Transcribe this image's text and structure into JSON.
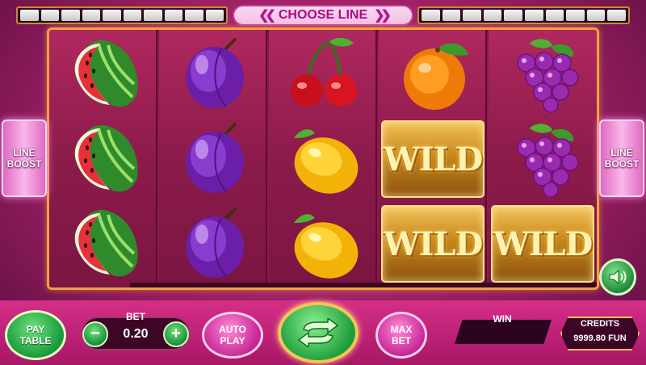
{
  "top_bar": {
    "choose_line_label": "CHOOSE LINE",
    "left_line_numbers": [
      "",
      "",
      "",
      "",
      "",
      "",
      "",
      "",
      "",
      ""
    ],
    "right_line_numbers": [
      "",
      "",
      "",
      "",
      "",
      "",
      "",
      "",
      "",
      ""
    ]
  },
  "side": {
    "line_boost_label": "LINE\nBOOST"
  },
  "reels": [
    [
      "watermelon",
      "watermelon",
      "watermelon"
    ],
    [
      "plum",
      "plum",
      "plum"
    ],
    [
      "cherries",
      "lemon",
      "lemon"
    ],
    [
      "orange",
      "wild",
      "wild"
    ],
    [
      "grapes",
      "grapes",
      "wild"
    ]
  ],
  "symbols": {
    "wild_text": "WILD"
  },
  "controls": {
    "pay_table_label": "PAY\nTABLE",
    "bet_label": "BET",
    "bet_value": "0.20",
    "minus_label": "−",
    "plus_label": "+",
    "auto_play_label": "AUTO\nPLAY",
    "max_bet_label": "MAX\nBET",
    "win_label": "WIN",
    "win_value": "",
    "credits_label": "CREDITS",
    "credits_value": "9999.80 FUN"
  },
  "icons": {
    "spin": "spin-arrows-icon",
    "sound": "speaker-icon"
  },
  "colors": {
    "background": "#b82473",
    "frame_gold": "#f0a23c",
    "green_button": "#1a913a",
    "pink_button": "#c72796"
  }
}
